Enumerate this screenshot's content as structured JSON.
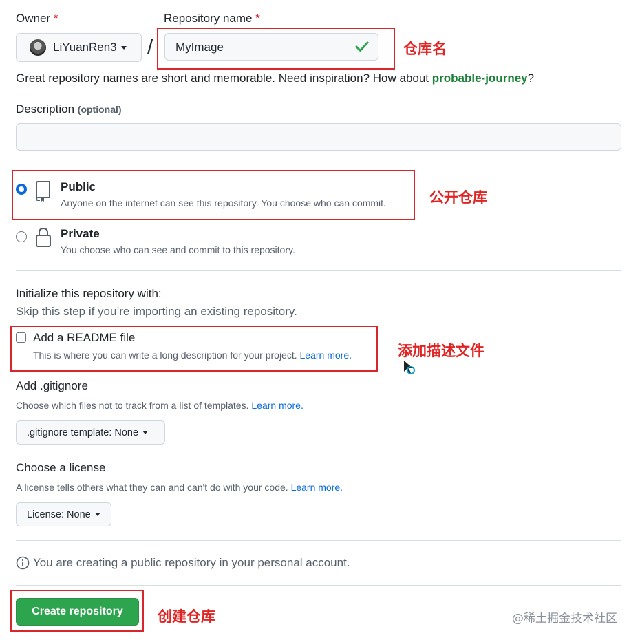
{
  "owner": {
    "label": "Owner",
    "required_mark": "*",
    "name": "LiYuanRen3",
    "separator": "/"
  },
  "repo_name": {
    "label": "Repository name",
    "required_mark": "*",
    "value": "MyImage"
  },
  "name_hint": {
    "prefix": "Great repository names are short and memorable. Need inspiration? How about ",
    "suggestion": "probable-journey",
    "suffix": "?"
  },
  "description": {
    "label": "Description",
    "optional": "(optional)",
    "value": ""
  },
  "visibility": {
    "public": {
      "title": "Public",
      "desc": "Anyone on the internet can see this repository. You choose who can commit.",
      "selected": true
    },
    "private": {
      "title": "Private",
      "desc": "You choose who can see and commit to this repository.",
      "selected": false
    }
  },
  "init": {
    "title": "Initialize this repository with:",
    "subtitle": "Skip this step if you’re importing an existing repository.",
    "readme_label": "Add a README file",
    "readme_desc": "This is where you can write a long description for your project.",
    "readme_link": "Learn more.",
    "readme_checked": false
  },
  "gitignore": {
    "title": "Add .gitignore",
    "desc": "Choose which files not to track from a list of templates.",
    "link": "Learn more.",
    "select_prefix": ".gitignore template:",
    "select_value": "None"
  },
  "license": {
    "title": "Choose a license",
    "desc": "A license tells others what they can and can't do with your code.",
    "link": "Learn more.",
    "select_prefix": "License:",
    "select_value": "None"
  },
  "notice": "You are creating a public repository in your personal account.",
  "create_button": "Create repository",
  "annotations": {
    "repo_name": "仓库名",
    "public": "公开仓库",
    "readme": "添加描述文件",
    "create": "创建仓库"
  },
  "watermark": "@稀土掘金技术社区",
  "colors": {
    "annotation_red": "#d9252c",
    "create_green": "#2da44e",
    "link_blue": "#0969da",
    "suggestion_green": "#1a7f37",
    "check_green": "#2da44e"
  }
}
